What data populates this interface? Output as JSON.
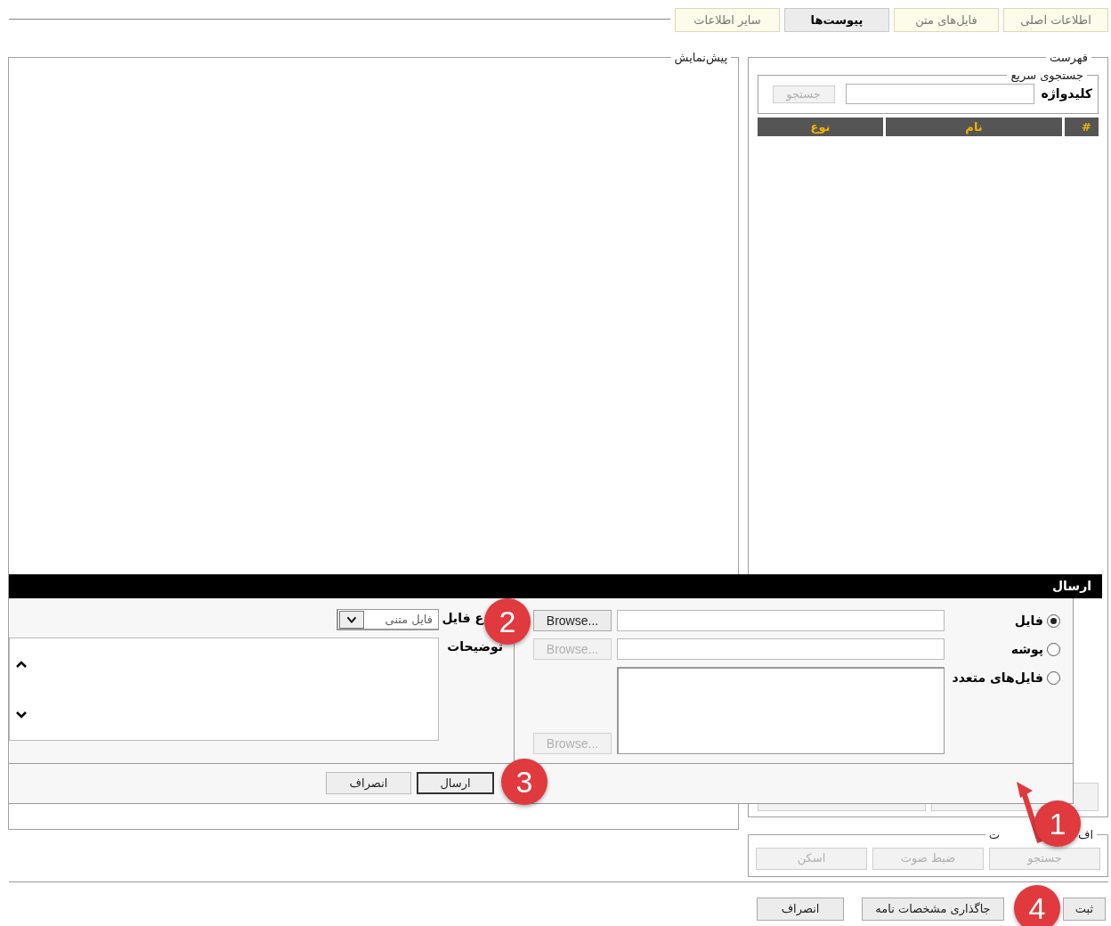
{
  "tabs": [
    {
      "label": "اطلاعات اصلی",
      "selected": false
    },
    {
      "label": "فایل‌های متن",
      "selected": false
    },
    {
      "label": "پیوست‌ها",
      "selected": true
    },
    {
      "label": "سایر اطلاعات",
      "selected": false
    }
  ],
  "list_panel": {
    "legend": "فهرست",
    "quick_search": {
      "legend": "جستجوی سریع",
      "keyword_label": "کلیدواژه",
      "search_button": {
        "label": "جستجو",
        "disabled": true
      }
    },
    "columns": [
      "#",
      "نام",
      "نوع"
    ]
  },
  "preview_panel": {
    "legend": "پیش‌نمایش"
  },
  "attach_panel": {
    "legend_parts": [
      "اف",
      "ت"
    ],
    "buttons": [
      {
        "label": "جستجو",
        "disabled": true
      },
      {
        "label": "ضبط صوت",
        "disabled": true
      },
      {
        "label": "اسکن",
        "disabled": true
      }
    ]
  },
  "send_dialog": {
    "title": "ارسال",
    "sources": [
      {
        "kind": "line",
        "label": "فایل",
        "selected": true,
        "browse": {
          "label": "Browse...",
          "disabled": false
        }
      },
      {
        "kind": "line",
        "label": "پوشه",
        "selected": false,
        "browse": {
          "label": "Browse...",
          "disabled": true
        }
      },
      {
        "kind": "list",
        "label": "فایل‌های متعدد",
        "selected": false,
        "browse": {
          "label": "Browse...",
          "disabled": true
        }
      }
    ],
    "file_type_label": "ع فایل",
    "file_type_value": "فایل متنی",
    "description_label": "توضیحات",
    "buttons": [
      {
        "label": "ارسال",
        "default": true
      },
      {
        "label": "انصراف",
        "default": false
      }
    ]
  },
  "footer_buttons": [
    {
      "label": "ثبت"
    },
    {
      "label": "جاگذاری مشخصات نامه"
    },
    {
      "label": "انصراف"
    }
  ],
  "markers": [
    "1",
    "2",
    "3",
    "4"
  ]
}
